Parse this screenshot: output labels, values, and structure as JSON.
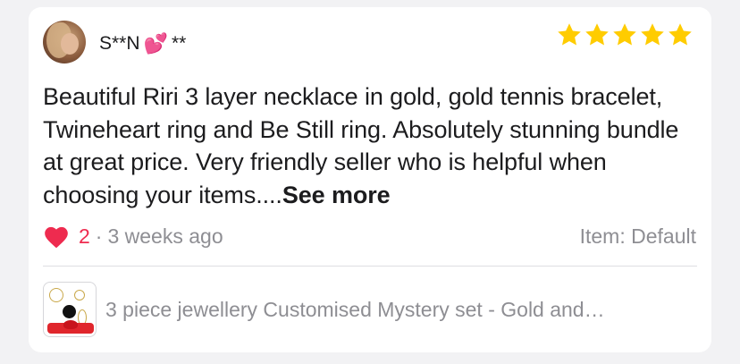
{
  "review": {
    "user_name": "S**N",
    "user_name_suffix": "**",
    "emoji": "💕",
    "rating": 5,
    "text": "Beautiful Riri 3 layer necklace in gold, gold tennis bracelet, Twineheart ring and Be Still ring. Absolutely stunning bundle at great price.  Very friendly seller who is helpful when choosing your items....",
    "see_more_label": "See more",
    "like_count": "2",
    "separator": "·",
    "time_ago": "3 weeks ago",
    "item_variant": "Item: Default"
  },
  "product": {
    "title": "3 piece jewellery Customised Mystery set - Gold and…"
  },
  "colors": {
    "star": "#ffcc00",
    "like": "#ee2b4f",
    "muted_text": "#8e8e93"
  }
}
